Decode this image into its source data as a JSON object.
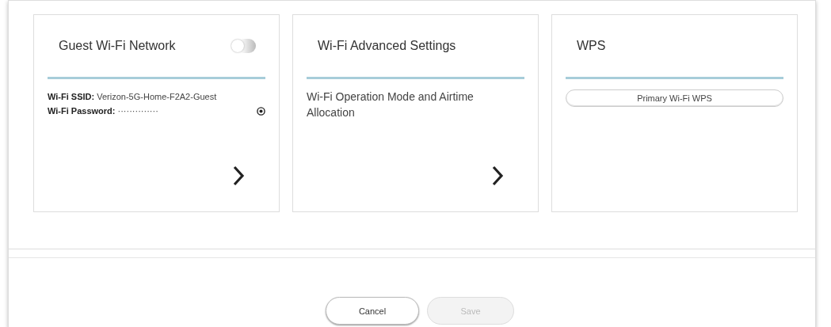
{
  "cards": [
    {
      "kind": "network",
      "title": "Guest Wi-Fi Network",
      "toggle": {
        "on": false
      },
      "fields": [
        {
          "label": "Wi-Fi SSID:",
          "value": "Verizon-5G-Home-F2A2-Guest"
        },
        {
          "label": "Wi-Fi Password:",
          "value": "··············",
          "reveal": true
        }
      ],
      "has_arrow": true
    },
    {
      "kind": "link",
      "title": "Wi-Fi Advanced Settings",
      "description": "Wi-Fi Operation Mode and Airtime Allocation",
      "has_arrow": true
    },
    {
      "kind": "actions",
      "title": "WPS",
      "buttons": [
        "Primary Wi-Fi WPS"
      ]
    }
  ],
  "footer": {
    "buttons": [
      {
        "label": "Cancel",
        "disabled": false
      },
      {
        "label": "Save",
        "disabled": true
      }
    ]
  }
}
